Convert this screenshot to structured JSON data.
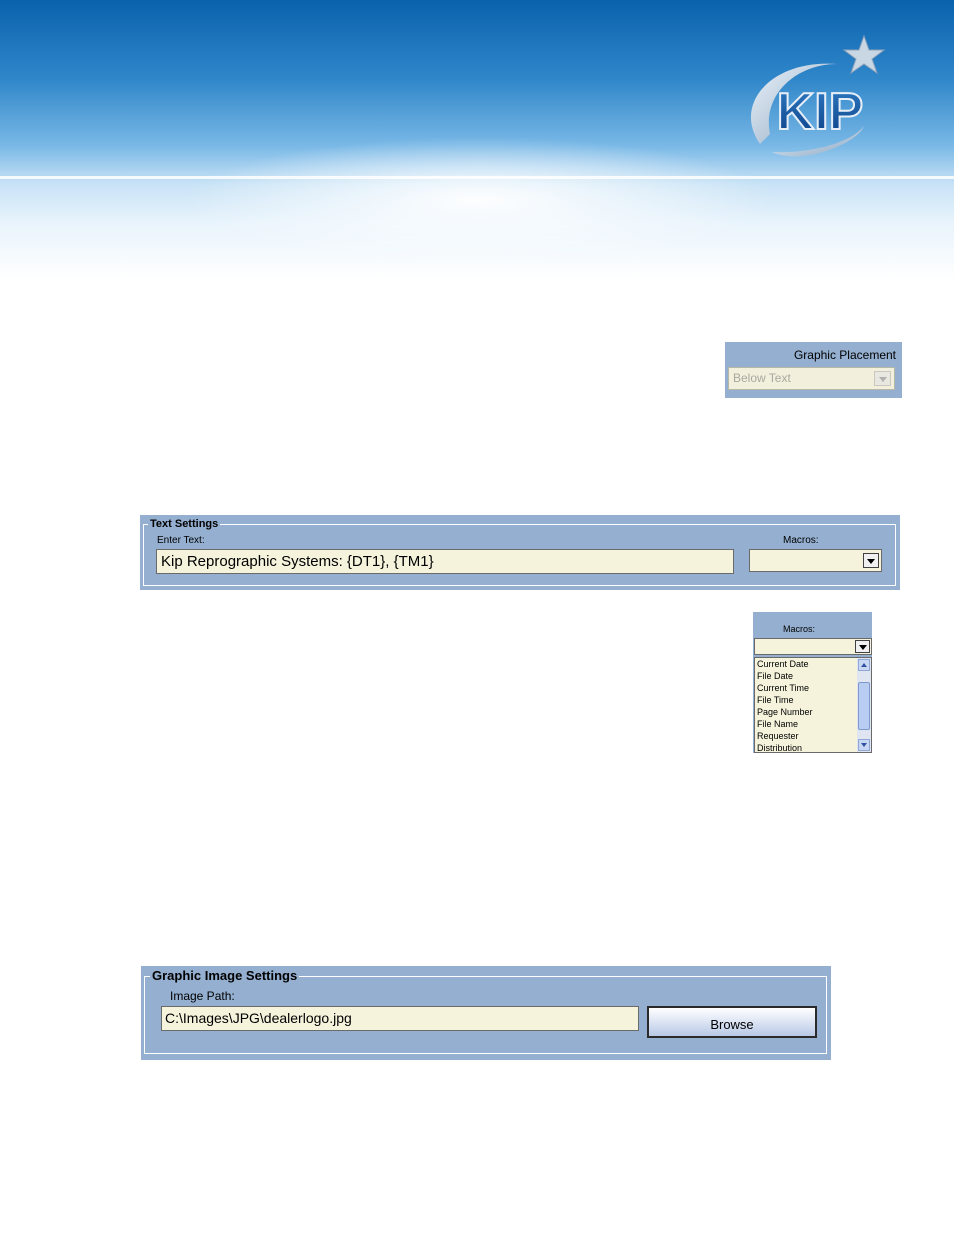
{
  "logo": {
    "text": "KIP"
  },
  "graphic_placement": {
    "label": "Graphic Placement",
    "selected": "Below Text"
  },
  "text_settings": {
    "legend": "Text Settings",
    "enter_text_label": "Enter Text:",
    "enter_text_value": "Kip Reprographic Systems: {DT1}, {TM1}",
    "macros_label": "Macros:",
    "macros_value": ""
  },
  "macros_dropdown": {
    "label": "Macros:",
    "items": [
      "Current Date",
      "File Date",
      "Current Time",
      "File Time",
      "Page Number",
      "File Name",
      "Requester",
      "Distribution"
    ]
  },
  "graphic_image_settings": {
    "legend": "Graphic Image Settings",
    "image_path_label": "Image Path:",
    "image_path_value": "C:\\Images\\JPG\\dealerlogo.jpg",
    "browse_label": "Browse"
  },
  "colors": {
    "panel": "#94afcf",
    "field": "#f5f3dc",
    "banner_top": "#0a62ad"
  }
}
